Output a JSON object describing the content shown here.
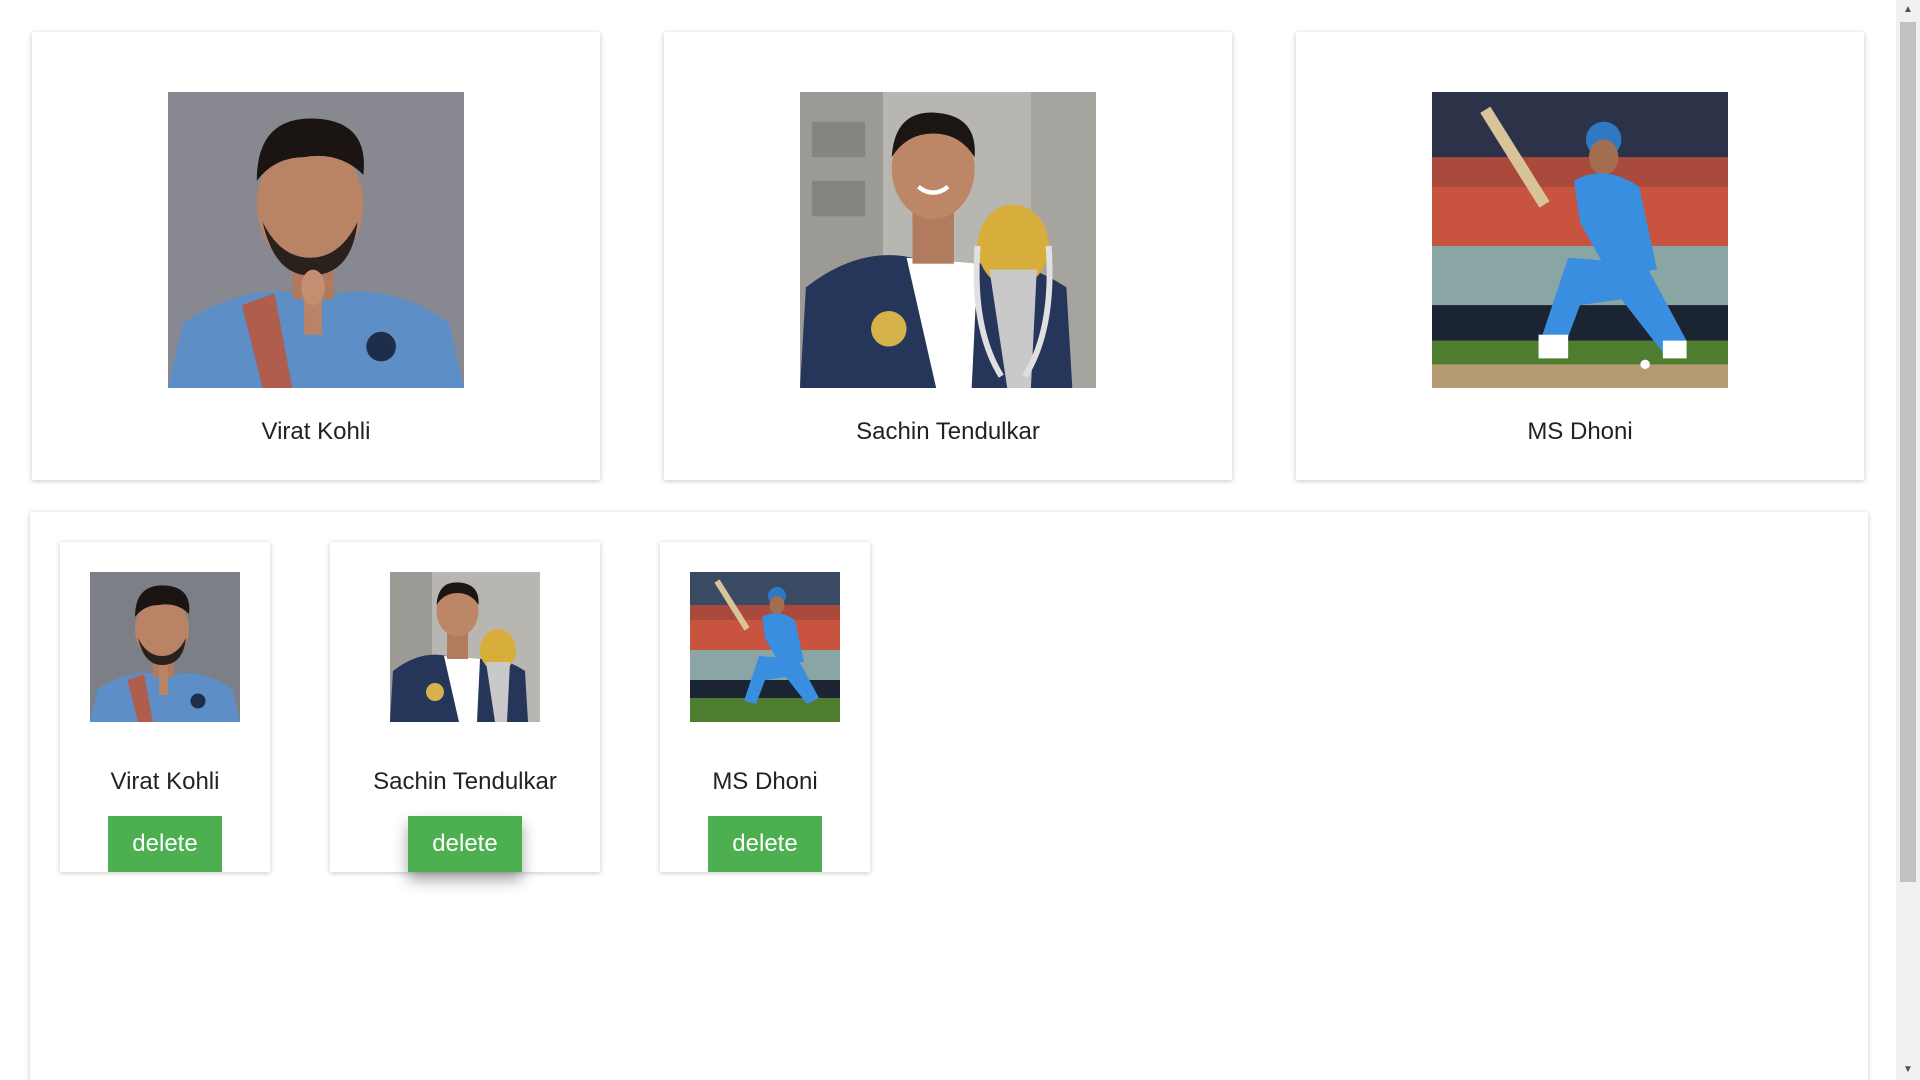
{
  "players": [
    {
      "name": "Virat Kohli"
    },
    {
      "name": "Sachin Tendulkar"
    },
    {
      "name": "MS Dhoni"
    }
  ],
  "selected": [
    {
      "name": "Virat Kohli",
      "delete_label": "delete"
    },
    {
      "name": "Sachin Tendulkar",
      "delete_label": "delete"
    },
    {
      "name": "MS Dhoni",
      "delete_label": "delete"
    }
  ],
  "scrollbar": {
    "up_arrow": "▲",
    "down_arrow": "▼"
  },
  "colors": {
    "delete_button": "#4caf50",
    "india_blue": "#3a7fc8"
  }
}
